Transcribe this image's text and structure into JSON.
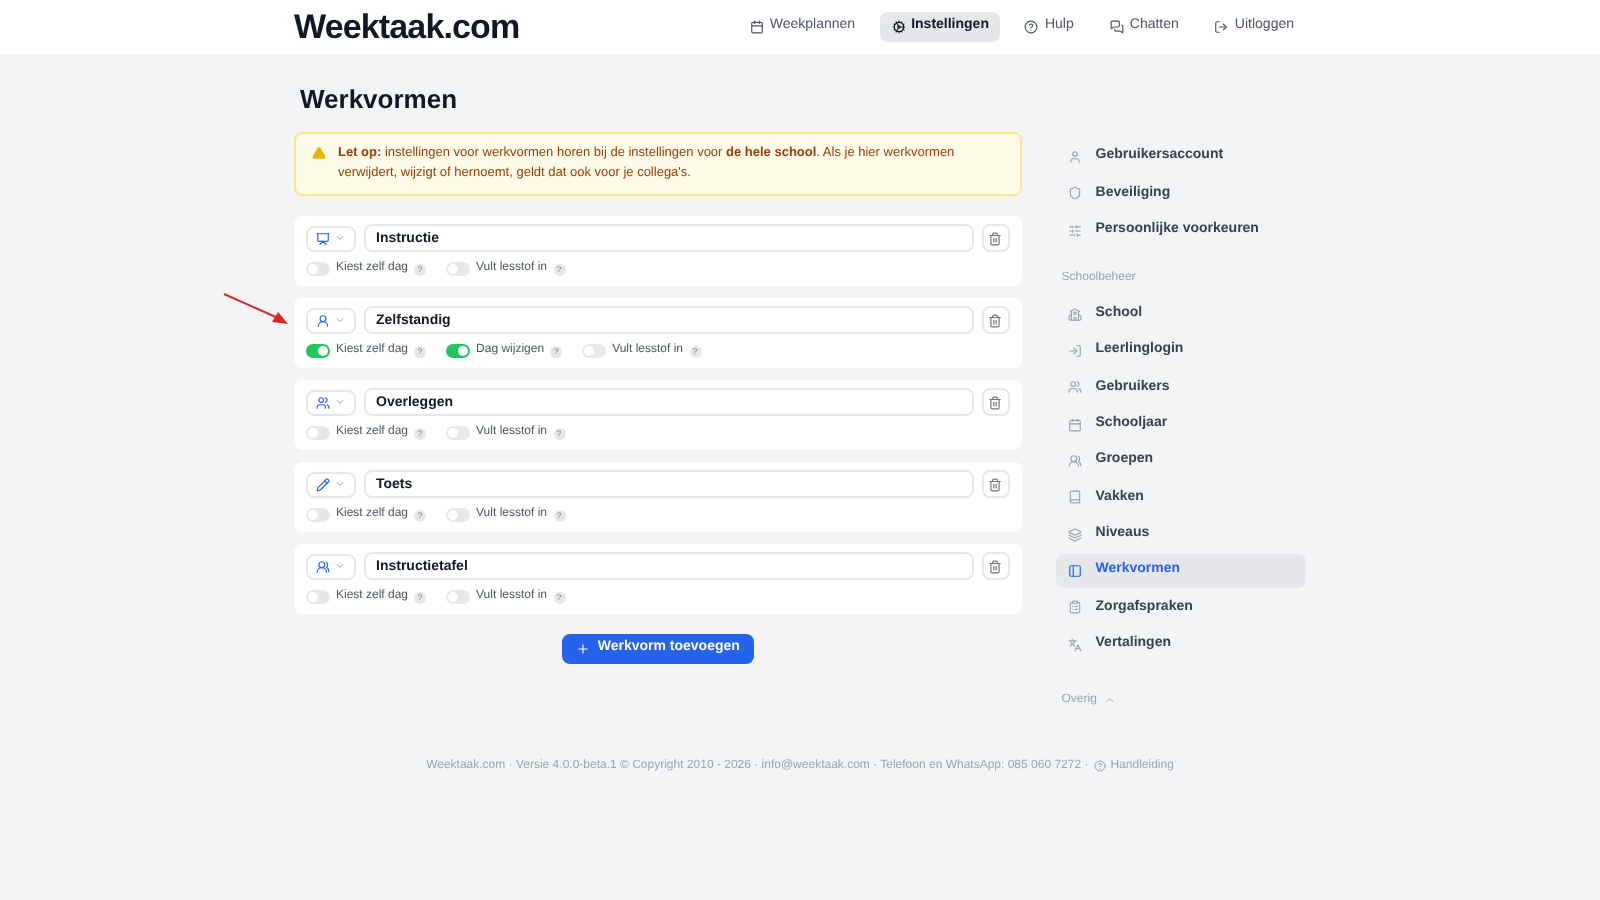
{
  "logo": "Weektaak.com",
  "nav": [
    {
      "label": "Weekplannen",
      "selected": false
    },
    {
      "label": "Instellingen",
      "selected": true
    },
    {
      "label": "Hulp",
      "selected": false
    },
    {
      "label": "Chatten",
      "selected": false
    },
    {
      "label": "Uitloggen",
      "selected": false
    }
  ],
  "title": "Werkvormen",
  "alert": "**Let op:** instellingen voor werkvormen horen bij de instellingen voor **de hele school**. Als je hier werkvormen verwijdert, wijzigt of hernoemt, geldt dat ook voor je collega's.",
  "rows": [
    {
      "value": "Instructie",
      "toggles": [
        {
          "label": "Kiest zelf dag",
          "help": "?",
          "on": false
        },
        {
          "label": "Vult lesstof in",
          "help": "?",
          "on": false
        }
      ]
    },
    {
      "value": "Zelfstandig",
      "toggles": [
        {
          "label": "Kiest zelf dag",
          "help": "?",
          "on": true
        },
        {
          "label": "Dag wijzigen",
          "help": "?",
          "on": true
        },
        {
          "label": "Vult lesstof in",
          "help": "?",
          "on": false
        }
      ]
    },
    {
      "value": "Overleggen",
      "toggles": [
        {
          "label": "Kiest zelf dag",
          "help": "?",
          "on": false
        },
        {
          "label": "Vult lesstof in",
          "help": "?",
          "on": false
        }
      ]
    },
    {
      "value": "Toets",
      "toggles": [
        {
          "label": "Kiest zelf dag",
          "help": "?",
          "on": false
        },
        {
          "label": "Vult lesstof in",
          "help": "?",
          "on": false
        }
      ]
    },
    {
      "value": "Instructietafel",
      "toggles": [
        {
          "label": "Kiest zelf dag",
          "help": "?",
          "on": false
        },
        {
          "label": "Vult lesstof in",
          "help": "?",
          "on": false
        }
      ]
    }
  ],
  "add_button": "Werkvorm toevoegen",
  "sidebar": [
    {
      "kind": "item",
      "label": "Gebruikersaccount",
      "selected": false
    },
    {
      "kind": "item",
      "label": "Beveiliging",
      "selected": false
    },
    {
      "kind": "item",
      "label": "Persoonlijke voorkeuren",
      "selected": false
    },
    {
      "kind": "heading",
      "label": "Schoolbeheer"
    },
    {
      "kind": "item",
      "label": "School",
      "selected": false
    },
    {
      "kind": "item",
      "label": "Leerlinglogin",
      "selected": false
    },
    {
      "kind": "item",
      "label": "Gebruikers",
      "selected": false
    },
    {
      "kind": "item",
      "label": "Schooljaar",
      "selected": false
    },
    {
      "kind": "item",
      "label": "Groepen",
      "selected": false
    },
    {
      "kind": "item",
      "label": "Vakken",
      "selected": false
    },
    {
      "kind": "item",
      "label": "Niveaus",
      "selected": false
    },
    {
      "kind": "item",
      "label": "Werkvormen",
      "selected": true
    },
    {
      "kind": "item",
      "label": "Zorgafspraken",
      "selected": false
    },
    {
      "kind": "item",
      "label": "Vertalingen",
      "selected": false
    },
    {
      "kind": "toggle",
      "label": "Overig",
      "expanded": true
    }
  ],
  "footer": {
    "text": "Weektaak.com · Versie 4.0.0-beta.1 © Copyright 2010 - 2026 · info@weektaak.com · Telefoon en WhatsApp: 085 060 7272 ·",
    "link": "Handleiding"
  }
}
